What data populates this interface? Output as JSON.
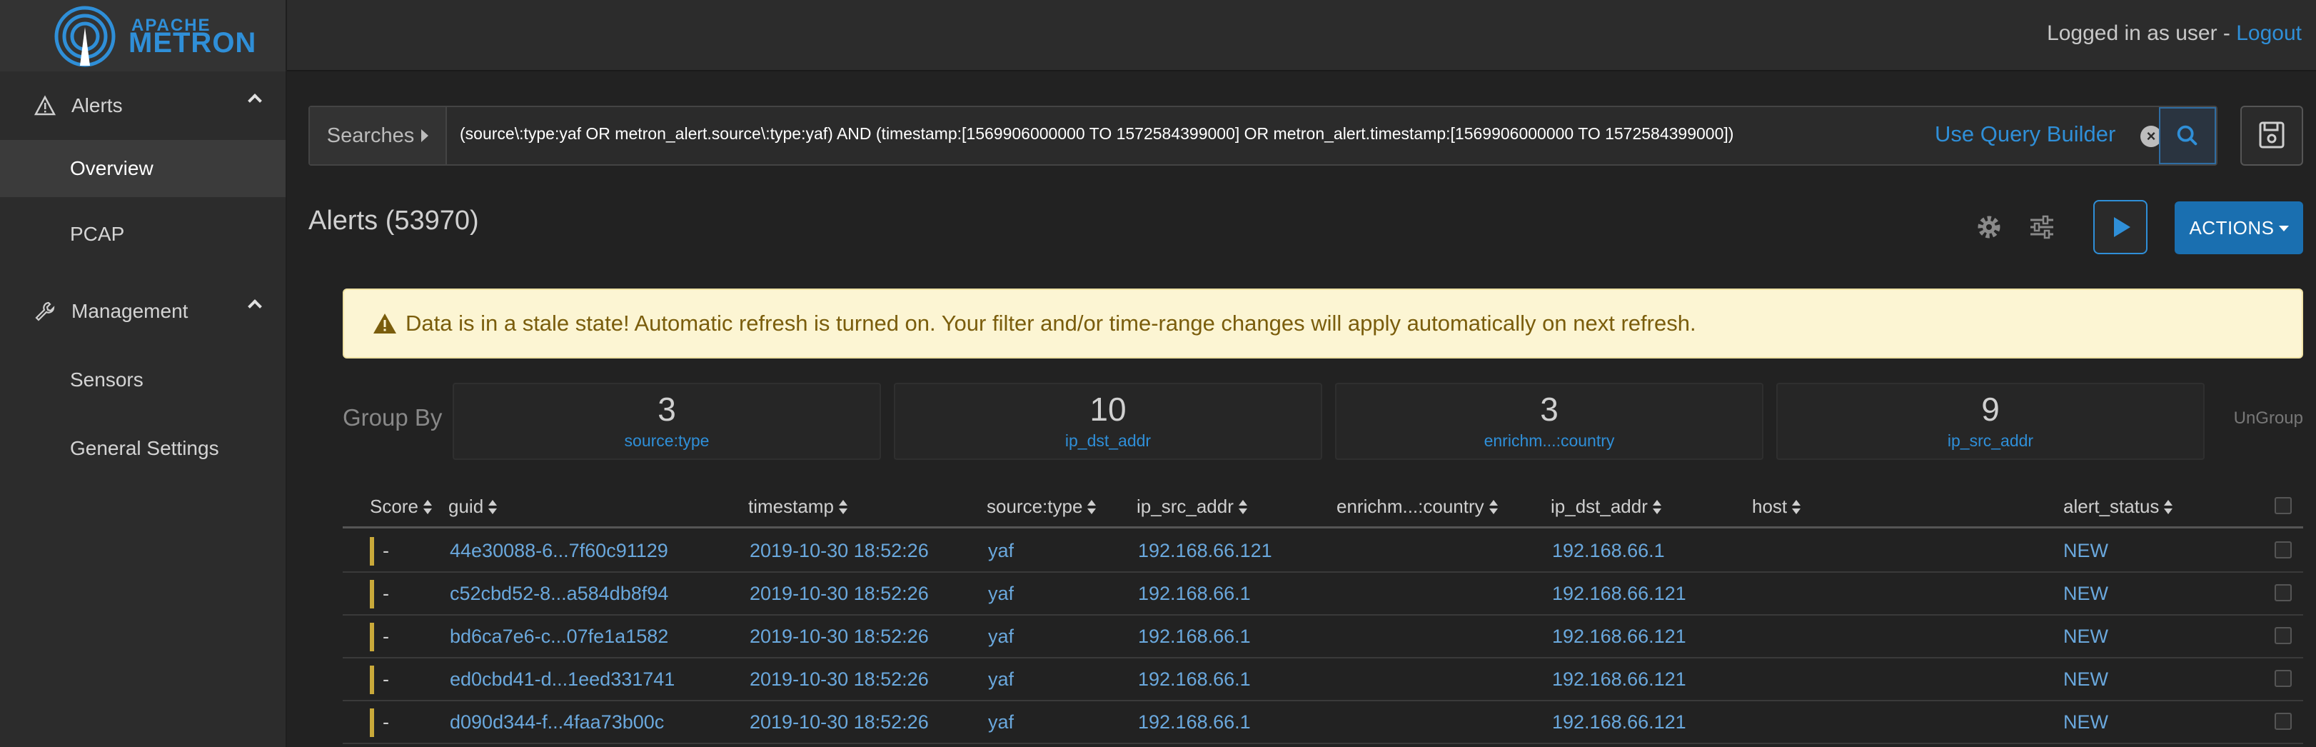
{
  "app": {
    "logo_small": "APACHE",
    "logo_big": "METRON",
    "login_text": "Logged in as user - ",
    "logout_label": "Logout"
  },
  "sidebar": {
    "groups": [
      {
        "label": "Alerts",
        "icon": "warning-triangle-icon",
        "items": [
          {
            "label": "Overview",
            "active": true
          },
          {
            "label": "PCAP",
            "active": false
          }
        ]
      },
      {
        "label": "Management",
        "icon": "wrench-icon",
        "items": [
          {
            "label": "Sensors",
            "active": false
          },
          {
            "label": "General Settings",
            "active": false
          }
        ]
      }
    ]
  },
  "search": {
    "searches_label": "Searches",
    "query": "(source\\:type:yaf OR metron_alert.source\\:type:yaf) AND (timestamp:[1569906000000 TO 1572584399000] OR metron_alert.timestamp:[1569906000000 TO 1572584399000])",
    "query_builder_label": "Use Query Builder"
  },
  "toolbar": {
    "title": "Alerts (53970)",
    "actions_label": "ACTIONS"
  },
  "warning": {
    "text": "Data is in a stale state! Automatic refresh is turned on. Your filter and/or time-range changes will apply automatically on next refresh."
  },
  "group_by": {
    "label": "Group By",
    "ungroup_label": "UnGroup",
    "groups": [
      {
        "count": "3",
        "name": "source:type"
      },
      {
        "count": "10",
        "name": "ip_dst_addr"
      },
      {
        "count": "3",
        "name": "enrichm...:country"
      },
      {
        "count": "9",
        "name": "ip_src_addr"
      }
    ]
  },
  "table": {
    "columns": [
      "Score",
      "guid",
      "timestamp",
      "source:type",
      "ip_src_addr",
      "enrichm...:country",
      "ip_dst_addr",
      "host",
      "alert_status"
    ],
    "rows": [
      {
        "score": "-",
        "guid": "44e30088-6...7f60c91129",
        "timestamp": "2019-10-30 18:52:26",
        "source_type": "yaf",
        "ip_src_addr": "192.168.66.121",
        "country": "",
        "ip_dst_addr": "192.168.66.1",
        "host": "",
        "alert_status": "NEW"
      },
      {
        "score": "-",
        "guid": "c52cbd52-8...a584db8f94",
        "timestamp": "2019-10-30 18:52:26",
        "source_type": "yaf",
        "ip_src_addr": "192.168.66.1",
        "country": "",
        "ip_dst_addr": "192.168.66.121",
        "host": "",
        "alert_status": "NEW"
      },
      {
        "score": "-",
        "guid": "bd6ca7e6-c...07fe1a1582",
        "timestamp": "2019-10-30 18:52:26",
        "source_type": "yaf",
        "ip_src_addr": "192.168.66.1",
        "country": "",
        "ip_dst_addr": "192.168.66.121",
        "host": "",
        "alert_status": "NEW"
      },
      {
        "score": "-",
        "guid": "ed0cbd41-d...1eed331741",
        "timestamp": "2019-10-30 18:52:26",
        "source_type": "yaf",
        "ip_src_addr": "192.168.66.1",
        "country": "",
        "ip_dst_addr": "192.168.66.121",
        "host": "",
        "alert_status": "NEW"
      },
      {
        "score": "-",
        "guid": "d090d344-f...4faa73b00c",
        "timestamp": "2019-10-30 18:52:26",
        "source_type": "yaf",
        "ip_src_addr": "192.168.66.1",
        "country": "",
        "ip_dst_addr": "192.168.66.121",
        "host": "",
        "alert_status": "NEW"
      }
    ]
  },
  "colors": {
    "accent": "#2f8fd8",
    "actions_button": "#1a6fb0",
    "warning_bg": "#fcf5d3",
    "row_marker": "#c9a93a"
  }
}
